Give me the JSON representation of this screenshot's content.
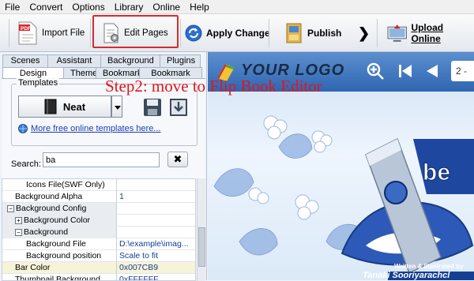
{
  "menu": [
    "File",
    "Convert",
    "Options",
    "Library",
    "Online",
    "Help"
  ],
  "toolbar": {
    "import_label": "Import File",
    "edit_label": "Edit Pages",
    "apply_label": "Apply Change",
    "publish_label": "Publish",
    "upload_label": "Upload Online"
  },
  "tabs_row1": [
    "Scenes",
    "Assistant",
    "Background",
    "Plugins"
  ],
  "tabs_row2": [
    "Design Setting",
    "Themes",
    "Bookmark",
    "Bookmark Tabs"
  ],
  "templates": {
    "label": "Templates",
    "selected": "Neat",
    "more_link": "More free online templates here..."
  },
  "search": {
    "label": "Search:",
    "value": "ba"
  },
  "properties": [
    {
      "name": "Icons File(SWF Only)",
      "value": "",
      "indent": 3,
      "toggle": ""
    },
    {
      "name": "Background Alpha",
      "value": "1",
      "indent": 1,
      "toggle": ""
    },
    {
      "name": "Background Config",
      "value": "",
      "indent": 0,
      "toggle": "−"
    },
    {
      "name": "Background Color",
      "value": "",
      "indent": 1,
      "toggle": "+"
    },
    {
      "name": "Background",
      "value": "",
      "indent": 1,
      "toggle": "−"
    },
    {
      "name": "Background File",
      "value": "D:\\example\\imag...",
      "indent": 3,
      "toggle": ""
    },
    {
      "name": "Background position",
      "value": "Scale to fit",
      "indent": 3,
      "toggle": ""
    },
    {
      "name": "Bar Color",
      "value": "0x007CB9",
      "indent": 1,
      "toggle": ""
    },
    {
      "name": "Thumbnail Background",
      "value": "0xFFFFFF",
      "indent": 1,
      "toggle": ""
    }
  ],
  "preview": {
    "logo_text": "YOUR LOGO",
    "page_indicator": "2 -",
    "credit": "Written & Illustrated by",
    "author": "Tanaki Sooriyarachcl"
  },
  "annotation": "Step2: move to Flip Book Editor",
  "colors": {
    "highlight": "#d62b2b",
    "annotation": "#e3141b",
    "viewer_bar": "#2f66b1"
  }
}
